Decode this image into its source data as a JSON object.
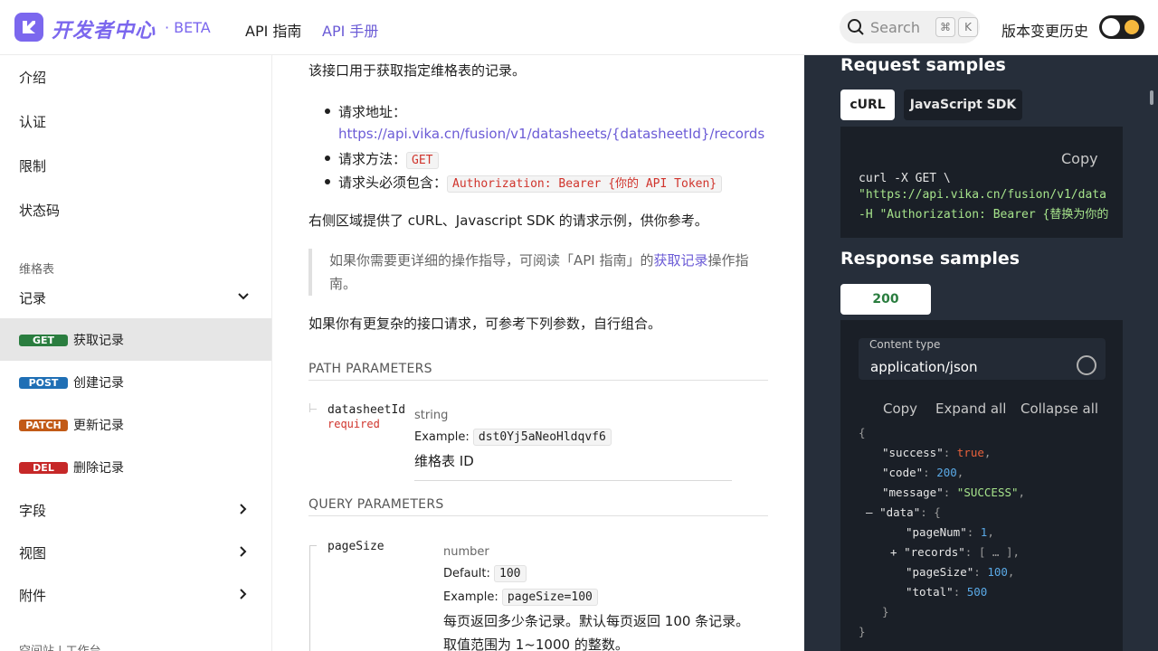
{
  "header": {
    "brand": "开发者中心",
    "beta": "· BETA",
    "nav_guide": "API 指南",
    "nav_manual": "API 手册",
    "search_placeholder": "Search",
    "kbd_cmd": "⌘",
    "kbd_k": "K",
    "changelog": "版本变更历史"
  },
  "sidebar": {
    "items_top": [
      "介绍",
      "认证",
      "限制",
      "状态码"
    ],
    "section_label": "维格表",
    "records_label": "记录",
    "methods": [
      {
        "method": "GET",
        "label": "获取记录",
        "color": "#2a7d3f"
      },
      {
        "method": "POST",
        "label": "创建记录",
        "color": "#1f6fb5"
      },
      {
        "method": "PATCH",
        "label": "更新记录",
        "color": "#c25a17"
      },
      {
        "method": "DEL",
        "label": "删除记录",
        "color": "#c62828"
      }
    ],
    "groups": [
      "字段",
      "视图",
      "附件"
    ],
    "footer_partial": "空间站 | 工作台"
  },
  "main": {
    "intro": "该接口用于获取指定维格表的记录。",
    "bullet1_label": "请求地址：",
    "bullet1_url": "https://api.vika.cn/fusion/v1/datasheets/{datasheetId}/records",
    "bullet2_label": "请求方法：",
    "bullet2_code": "GET",
    "bullet3_label": "请求头必须包含：",
    "bullet3_code": "Authorization: Bearer {你的 API Token}",
    "para2": "右侧区域提供了 cURL、Javascript SDK 的请求示例，供你参考。",
    "quote_pre": "如果你需要更详细的操作指导，可阅读「API 指南」的",
    "quote_link": "获取记录",
    "quote_post": "操作指南。",
    "para3": "如果你有更复杂的接口请求，可参考下列参数，自行组合。",
    "path_params_title": "PATH PARAMETERS",
    "p1_name": "datasheetId",
    "p1_required": "required",
    "p1_type": "string",
    "p1_example_label": "Example:",
    "p1_example": "dst0Yj5aNeoHldqvf6",
    "p1_desc": "维格表 ID",
    "query_params_title": "QUERY PARAMETERS",
    "p2_name": "pageSize",
    "p2_type": "number",
    "p2_default_label": "Default:",
    "p2_default": "100",
    "p2_example_label": "Example:",
    "p2_example": "pageSize=100",
    "p2_desc1": "每页返回多少条记录。默认每页返回 100 条记录。",
    "p2_desc2": "取值范围为 1~1000 的整数。"
  },
  "right": {
    "request_title": "Request samples",
    "tab_curl": "cURL",
    "tab_sdk": "JavaScript SDK",
    "copy": "Copy",
    "curl_line1": "curl -X GET \\",
    "curl_line2": "\"https://api.vika.cn/fusion/v1/data",
    "curl_line3": "-H \"Authorization: Bearer {替换为你的",
    "response_title": "Response samples",
    "tab_200": "200",
    "content_type_label": "Content type",
    "content_type_value": "application/json",
    "ctrl_copy": "Copy",
    "ctrl_expand": "Expand all",
    "ctrl_collapse": "Collapse all",
    "json": {
      "success": "true",
      "code": "200",
      "message": "\"SUCCESS\"",
      "pageNum": "1",
      "records_collapsed": "[ … ]",
      "pageSize": "100",
      "total": "500"
    }
  }
}
